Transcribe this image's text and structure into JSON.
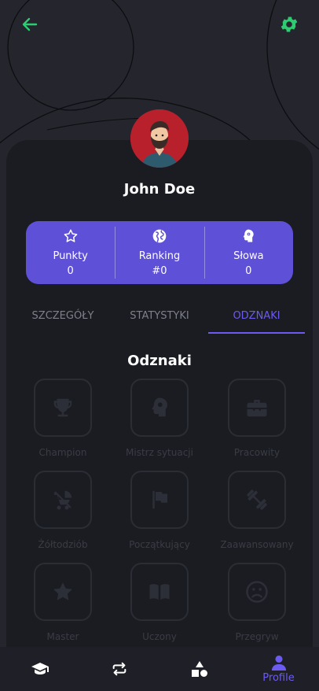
{
  "header": {
    "back_icon": "arrow-left-icon",
    "settings_icon": "gear-icon",
    "accent_color": "#2ecc71"
  },
  "profile": {
    "name": "John Doe",
    "avatar_icon": "user-avatar",
    "avatar_bg": "#b8202c"
  },
  "stats": [
    {
      "icon": "star-icon",
      "label": "Punkty",
      "value": "0"
    },
    {
      "icon": "globe-icon",
      "label": "Ranking",
      "value": "#0"
    },
    {
      "icon": "brain-icon",
      "label": "Słowa",
      "value": "0"
    }
  ],
  "tabs": [
    {
      "label": "SZCZEGÓŁY",
      "active": false
    },
    {
      "label": "STATYSTYKI",
      "active": false
    },
    {
      "label": "ODZNAKI",
      "active": true
    }
  ],
  "badges_section": {
    "title": "Odznaki",
    "badges": [
      {
        "label": "Champion",
        "icon": "trophy-icon"
      },
      {
        "label": "Mistrz sytuacji",
        "icon": "brain-icon"
      },
      {
        "label": "Pracowity",
        "icon": "toolbox-icon"
      },
      {
        "label": "Żółtodziób",
        "icon": "stroller-icon"
      },
      {
        "label": "Początkujący",
        "icon": "flag-icon"
      },
      {
        "label": "Zaawansowany",
        "icon": "dumbbell-icon"
      },
      {
        "label": "Master",
        "icon": "star-icon"
      },
      {
        "label": "Uczony",
        "icon": "book-icon"
      },
      {
        "label": "Przegryw",
        "icon": "sad-face-icon"
      }
    ]
  },
  "bottom_nav": {
    "items": [
      {
        "icon": "graduation-cap-icon",
        "label": ""
      },
      {
        "icon": "repeat-icon",
        "label": ""
      },
      {
        "icon": "shapes-icon",
        "label": ""
      },
      {
        "icon": "user-icon",
        "label": "Profile"
      }
    ],
    "active_color": "#6b5bf0"
  }
}
